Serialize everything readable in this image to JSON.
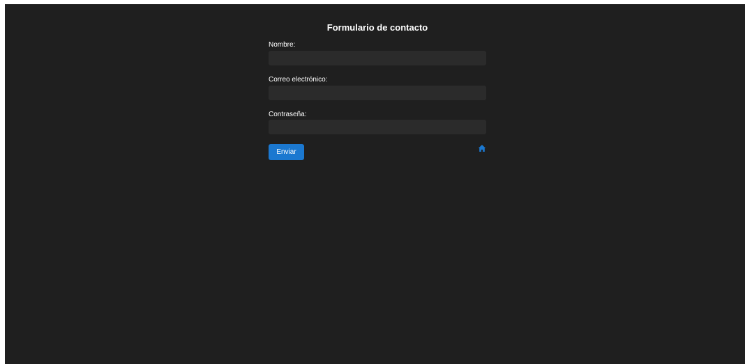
{
  "form": {
    "title": "Formulario de contacto",
    "fields": [
      {
        "label": "Nombre:",
        "value": "",
        "placeholder": ""
      },
      {
        "label": "Correo electrónico:",
        "value": "",
        "placeholder": ""
      },
      {
        "label": "Contraseña:",
        "value": "",
        "placeholder": ""
      }
    ],
    "submit_label": "Enviar",
    "home_icon": "home-icon"
  },
  "colors": {
    "background": "#1f1f1f",
    "input_background": "#2b2b2b",
    "accent": "#1b78d0",
    "text": "#ffffff"
  }
}
